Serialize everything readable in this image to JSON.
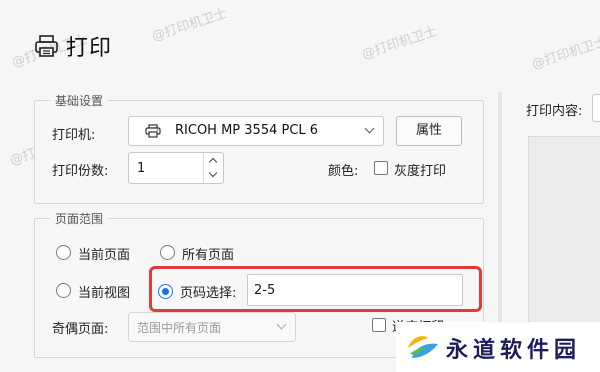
{
  "title": "打印",
  "basic_group": {
    "legend": "基础设置",
    "printer_label": "打印机:",
    "printer_value": "RICOH MP 3554 PCL 6",
    "properties_button": "属性",
    "copies_label": "打印份数:",
    "copies_value": "1",
    "color_label": "颜色:",
    "grayscale_label": "灰度打印",
    "grayscale_checked": false
  },
  "range_group": {
    "legend": "页面范围",
    "current_page": "当前页面",
    "all_pages": "所有页面",
    "current_view": "当前视图",
    "page_select_label": "页码选择:",
    "page_select_value": "2-5",
    "selected_option": "page_select",
    "odd_even_label": "奇偶页面:",
    "odd_even_value": "范围中所有页面",
    "reverse_label": "逆序打印"
  },
  "right_panel": {
    "content_label": "打印内容:"
  },
  "watermark_text": "@打印机卫士",
  "brand_text": "永道软件园",
  "colors": {
    "accent": "#1a73e8",
    "highlight": "#e03a3a",
    "brand": "#1d1d5e"
  }
}
